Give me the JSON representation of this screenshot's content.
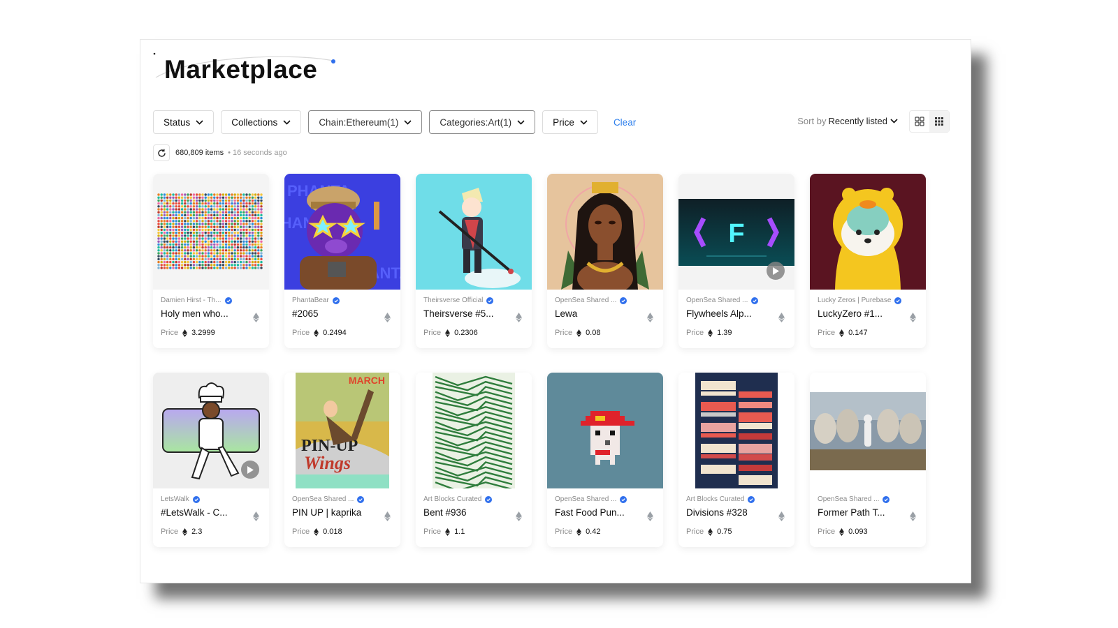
{
  "page": {
    "title": "Marketplace"
  },
  "filters": {
    "status": "Status",
    "collections": "Collections",
    "chain": "Chain:Ethereum(1)",
    "categories": "Categories:Art(1)",
    "price": "Price",
    "clear": "Clear"
  },
  "sort": {
    "label": "Sort by",
    "value": "Recently listed"
  },
  "status_bar": {
    "count": "680,809 items",
    "ago": "• 16 seconds ago"
  },
  "price_label": "Price",
  "items": [
    {
      "collection": "Damien Hirst - Th...",
      "name": "Holy men who...",
      "price": "3.2999",
      "art": "dots"
    },
    {
      "collection": "PhantaBear",
      "name": "#2065",
      "price": "0.2494",
      "art": "bear"
    },
    {
      "collection": "Theirsverse Official",
      "name": "Theirsverse #5...",
      "price": "0.2306",
      "art": "warrior"
    },
    {
      "collection": "OpenSea Shared ...",
      "name": "Lewa",
      "price": "0.08",
      "art": "portrait"
    },
    {
      "collection": "OpenSea Shared ...",
      "name": "Flywheels Alp...",
      "price": "1.39",
      "art": "neon"
    },
    {
      "collection": "Lucky Zeros | Purebase",
      "name": "LuckyZero #1...",
      "price": "0.147",
      "art": "dog"
    },
    {
      "collection": "LetsWalk",
      "name": "#LetsWalk - C...",
      "price": "2.3",
      "art": "chef"
    },
    {
      "collection": "OpenSea Shared ...",
      "name": "PIN UP | kaprika",
      "price": "0.018",
      "art": "pinup"
    },
    {
      "collection": "Art Blocks Curated",
      "name": "Bent #936",
      "price": "1.1",
      "art": "maze"
    },
    {
      "collection": "OpenSea Shared ...",
      "name": "Fast Food Pun...",
      "price": "0.42",
      "art": "punk"
    },
    {
      "collection": "Art Blocks Curated",
      "name": "Divisions #328",
      "price": "0.75",
      "art": "stripes"
    },
    {
      "collection": "OpenSea Shared ...",
      "name": "Former Path T...",
      "price": "0.093",
      "art": "statues"
    }
  ],
  "art_text": {
    "phanta": "PHANTA",
    "march": "MARCH",
    "pinup": "PIN-UP",
    "wings": "Wings",
    "neon": "F"
  },
  "colors": {
    "accent": "#2f80ed",
    "verified": "#2f6fed"
  }
}
